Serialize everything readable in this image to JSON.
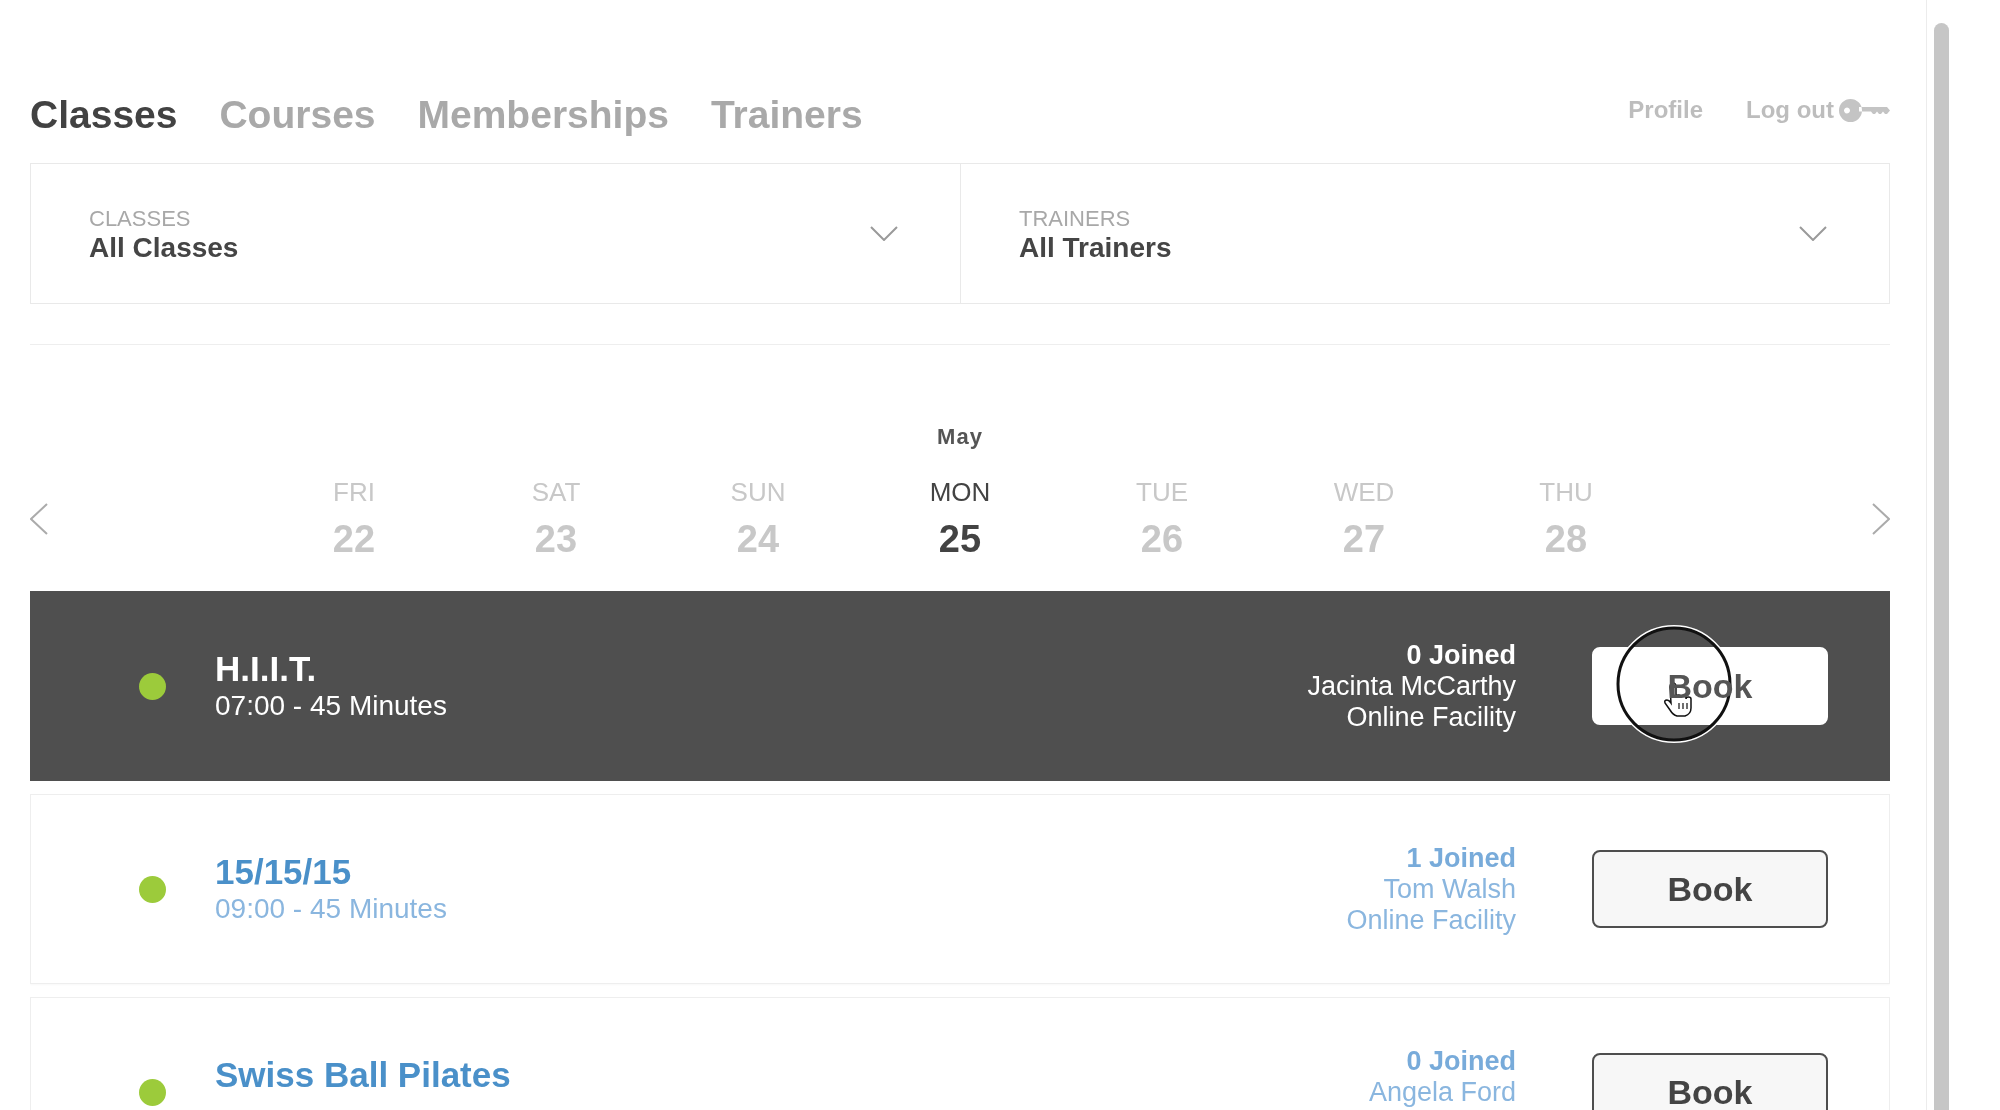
{
  "nav": {
    "tabs": [
      {
        "label": "Classes",
        "selected": true
      },
      {
        "label": "Courses",
        "selected": false
      },
      {
        "label": "Memberships",
        "selected": false
      },
      {
        "label": "Trainers",
        "selected": false
      }
    ],
    "links": [
      {
        "label": "Profile",
        "kind": "text"
      },
      {
        "label": "Log out",
        "kind": "logout"
      }
    ]
  },
  "filters": [
    {
      "label": "CLASSES",
      "value": "All Classes"
    },
    {
      "label": "TRAINERS",
      "value": "All Trainers"
    }
  ],
  "calendar": {
    "month": "May",
    "days": [
      {
        "weekday": "FRI",
        "date": "22",
        "selected": false
      },
      {
        "weekday": "SAT",
        "date": "23",
        "selected": false
      },
      {
        "weekday": "SUN",
        "date": "24",
        "selected": false
      },
      {
        "weekday": "MON",
        "date": "25",
        "selected": true
      },
      {
        "weekday": "TUE",
        "date": "26",
        "selected": false
      },
      {
        "weekday": "WED",
        "date": "27",
        "selected": false
      },
      {
        "weekday": "THU",
        "date": "28",
        "selected": false
      }
    ]
  },
  "classes": [
    {
      "name": "H.I.I.T.",
      "time": "07:00 - 45 Minutes",
      "joined": "0 Joined",
      "trainer": "Jacinta McCarthy",
      "facility": "Online Facility",
      "button": "Book",
      "color": "#9ccb3b",
      "selected": true
    },
    {
      "name": "15/15/15",
      "time": "09:00 - 45 Minutes",
      "joined": "1 Joined",
      "trainer": "Tom Walsh",
      "facility": "Online Facility",
      "button": "Book",
      "color": "#9ccb3b",
      "selected": false
    },
    {
      "name": "Swiss Ball Pilates",
      "joined": "0 Joined",
      "trainer": "Angela Ford",
      "button": "Book",
      "color": "#9ccb3b",
      "selected": false
    }
  ]
}
